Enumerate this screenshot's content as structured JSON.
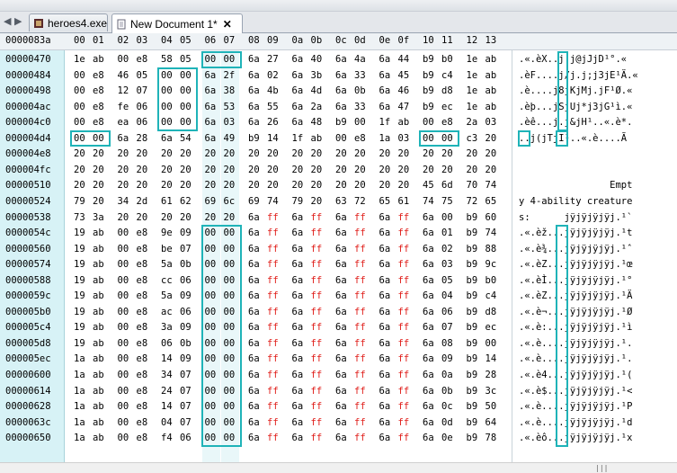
{
  "tabs": [
    {
      "label": "heroes4.exe",
      "icon": "exe-file-icon"
    },
    {
      "label": "New Document 1*",
      "icon": "new-document-icon",
      "close": "✕"
    }
  ],
  "nav": {
    "back": "◀",
    "forward": "▶"
  },
  "header": {
    "offset": "0000083a",
    "columns": [
      "00",
      "01",
      "02",
      "03",
      "04",
      "05",
      "06",
      "07",
      "08",
      "09",
      "0a",
      "0b",
      "0c",
      "0d",
      "0e",
      "0f",
      "10",
      "11",
      "12",
      "13"
    ]
  },
  "rows": [
    {
      "offset": "00000470",
      "bytes": [
        "1e",
        "ab",
        "00",
        "e8",
        "58",
        "05",
        "00",
        "00",
        "6a",
        "27",
        "6a",
        "40",
        "6a",
        "4a",
        "6a",
        "44",
        "b9",
        "b0",
        "1e",
        "ab"
      ],
      "text": ".«.èX..j'j@jJjD¹°.«"
    },
    {
      "offset": "00000484",
      "bytes": [
        "00",
        "e8",
        "46",
        "05",
        "00",
        "00",
        "6a",
        "2f",
        "6a",
        "02",
        "6a",
        "3b",
        "6a",
        "33",
        "6a",
        "45",
        "b9",
        "c4",
        "1e",
        "ab"
      ],
      "text": ".èF....j/j.j;j3jE¹Ä.«"
    },
    {
      "offset": "00000498",
      "bytes": [
        "00",
        "e8",
        "12",
        "07",
        "00",
        "00",
        "6a",
        "38",
        "6a",
        "4b",
        "6a",
        "4d",
        "6a",
        "0b",
        "6a",
        "46",
        "b9",
        "d8",
        "1e",
        "ab"
      ],
      "text": ".è....j8jKjMj.jF¹Ø.«"
    },
    {
      "offset": "000004ac",
      "bytes": [
        "00",
        "e8",
        "fe",
        "06",
        "00",
        "00",
        "6a",
        "53",
        "6a",
        "55",
        "6a",
        "2a",
        "6a",
        "33",
        "6a",
        "47",
        "b9",
        "ec",
        "1e",
        "ab"
      ],
      "text": ".èþ...jSjUj*j3jG¹ì.«"
    },
    {
      "offset": "000004c0",
      "bytes": [
        "00",
        "e8",
        "ea",
        "06",
        "00",
        "00",
        "6a",
        "03",
        "6a",
        "26",
        "6a",
        "48",
        "b9",
        "00",
        "1f",
        "ab",
        "00",
        "e8",
        "2a",
        "03"
      ],
      "text": ".èê...j.j&jH¹..«.è*."
    },
    {
      "offset": "000004d4",
      "bytes": [
        "00",
        "00",
        "6a",
        "28",
        "6a",
        "54",
        "6a",
        "49",
        "b9",
        "14",
        "1f",
        "ab",
        "00",
        "e8",
        "1a",
        "03",
        "00",
        "00",
        "c3",
        "20"
      ],
      "text": "..j(jTjI¹..«.è....Ã "
    },
    {
      "offset": "000004e8",
      "bytes": [
        "20",
        "20",
        "20",
        "20",
        "20",
        "20",
        "20",
        "20",
        "20",
        "20",
        "20",
        "20",
        "20",
        "20",
        "20",
        "20",
        "20",
        "20",
        "20",
        "20"
      ],
      "text": ""
    },
    {
      "offset": "000004fc",
      "bytes": [
        "20",
        "20",
        "20",
        "20",
        "20",
        "20",
        "20",
        "20",
        "20",
        "20",
        "20",
        "20",
        "20",
        "20",
        "20",
        "20",
        "20",
        "20",
        "20",
        "20"
      ],
      "text": ""
    },
    {
      "offset": "00000510",
      "bytes": [
        "20",
        "20",
        "20",
        "20",
        "20",
        "20",
        "20",
        "20",
        "20",
        "20",
        "20",
        "20",
        "20",
        "20",
        "20",
        "20",
        "45",
        "6d",
        "70",
        "74"
      ],
      "text": "                Empt"
    },
    {
      "offset": "00000524",
      "bytes": [
        "79",
        "20",
        "34",
        "2d",
        "61",
        "62",
        "69",
        "6c",
        "69",
        "74",
        "79",
        "20",
        "63",
        "72",
        "65",
        "61",
        "74",
        "75",
        "72",
        "65"
      ],
      "text": "y 4-ability creature"
    },
    {
      "offset": "00000538",
      "bytes": [
        "73",
        "3a",
        "20",
        "20",
        "20",
        "20",
        "20",
        "20",
        "6a",
        "ff",
        "6a",
        "ff",
        "6a",
        "ff",
        "6a",
        "ff",
        "6a",
        "00",
        "b9",
        "60"
      ],
      "text": "s:      jÿjÿjÿjÿj.¹`"
    },
    {
      "offset": "0000054c",
      "bytes": [
        "19",
        "ab",
        "00",
        "e8",
        "9e",
        "09",
        "00",
        "00",
        "6a",
        "ff",
        "6a",
        "ff",
        "6a",
        "ff",
        "6a",
        "ff",
        "6a",
        "01",
        "b9",
        "74"
      ],
      "text": ".«.èž...jÿjÿjÿjÿj.¹t"
    },
    {
      "offset": "00000560",
      "bytes": [
        "19",
        "ab",
        "00",
        "e8",
        "be",
        "07",
        "00",
        "00",
        "6a",
        "ff",
        "6a",
        "ff",
        "6a",
        "ff",
        "6a",
        "ff",
        "6a",
        "02",
        "b9",
        "88"
      ],
      "text": ".«.è¾...jÿjÿjÿjÿj.¹ˆ"
    },
    {
      "offset": "00000574",
      "bytes": [
        "19",
        "ab",
        "00",
        "e8",
        "5a",
        "0b",
        "00",
        "00",
        "6a",
        "ff",
        "6a",
        "ff",
        "6a",
        "ff",
        "6a",
        "ff",
        "6a",
        "03",
        "b9",
        "9c"
      ],
      "text": ".«.èZ...jÿjÿjÿjÿj.¹œ"
    },
    {
      "offset": "00000588",
      "bytes": [
        "19",
        "ab",
        "00",
        "e8",
        "cc",
        "06",
        "00",
        "00",
        "6a",
        "ff",
        "6a",
        "ff",
        "6a",
        "ff",
        "6a",
        "ff",
        "6a",
        "05",
        "b9",
        "b0"
      ],
      "text": ".«.èÌ...jÿjÿjÿjÿj.¹°"
    },
    {
      "offset": "0000059c",
      "bytes": [
        "19",
        "ab",
        "00",
        "e8",
        "5a",
        "09",
        "00",
        "00",
        "6a",
        "ff",
        "6a",
        "ff",
        "6a",
        "ff",
        "6a",
        "ff",
        "6a",
        "04",
        "b9",
        "c4"
      ],
      "text": ".«.èZ...jÿjÿjÿjÿj.¹Ä"
    },
    {
      "offset": "000005b0",
      "bytes": [
        "19",
        "ab",
        "00",
        "e8",
        "ac",
        "06",
        "00",
        "00",
        "6a",
        "ff",
        "6a",
        "ff",
        "6a",
        "ff",
        "6a",
        "ff",
        "6a",
        "06",
        "b9",
        "d8"
      ],
      "text": ".«.è¬...jÿjÿjÿjÿj.¹Ø"
    },
    {
      "offset": "000005c4",
      "bytes": [
        "19",
        "ab",
        "00",
        "e8",
        "3a",
        "09",
        "00",
        "00",
        "6a",
        "ff",
        "6a",
        "ff",
        "6a",
        "ff",
        "6a",
        "ff",
        "6a",
        "07",
        "b9",
        "ec"
      ],
      "text": ".«.è:...jÿjÿjÿjÿj.¹ì"
    },
    {
      "offset": "000005d8",
      "bytes": [
        "19",
        "ab",
        "00",
        "e8",
        "06",
        "0b",
        "00",
        "00",
        "6a",
        "ff",
        "6a",
        "ff",
        "6a",
        "ff",
        "6a",
        "ff",
        "6a",
        "08",
        "b9",
        "00"
      ],
      "text": ".«.è....jÿjÿjÿjÿj.¹."
    },
    {
      "offset": "000005ec",
      "bytes": [
        "1a",
        "ab",
        "00",
        "e8",
        "14",
        "09",
        "00",
        "00",
        "6a",
        "ff",
        "6a",
        "ff",
        "6a",
        "ff",
        "6a",
        "ff",
        "6a",
        "09",
        "b9",
        "14"
      ],
      "text": ".«.è....jÿjÿjÿjÿj.¹."
    },
    {
      "offset": "00000600",
      "bytes": [
        "1a",
        "ab",
        "00",
        "e8",
        "34",
        "07",
        "00",
        "00",
        "6a",
        "ff",
        "6a",
        "ff",
        "6a",
        "ff",
        "6a",
        "ff",
        "6a",
        "0a",
        "b9",
        "28"
      ],
      "text": ".«.è4...jÿjÿjÿjÿj.¹("
    },
    {
      "offset": "00000614",
      "bytes": [
        "1a",
        "ab",
        "00",
        "e8",
        "24",
        "07",
        "00",
        "00",
        "6a",
        "ff",
        "6a",
        "ff",
        "6a",
        "ff",
        "6a",
        "ff",
        "6a",
        "0b",
        "b9",
        "3c"
      ],
      "text": ".«.è$...jÿjÿjÿjÿj.¹<"
    },
    {
      "offset": "00000628",
      "bytes": [
        "1a",
        "ab",
        "00",
        "e8",
        "14",
        "07",
        "00",
        "00",
        "6a",
        "ff",
        "6a",
        "ff",
        "6a",
        "ff",
        "6a",
        "ff",
        "6a",
        "0c",
        "b9",
        "50"
      ],
      "text": ".«.è....jÿjÿjÿjÿj.¹P"
    },
    {
      "offset": "0000063c",
      "bytes": [
        "1a",
        "ab",
        "00",
        "e8",
        "04",
        "07",
        "00",
        "00",
        "6a",
        "ff",
        "6a",
        "ff",
        "6a",
        "ff",
        "6a",
        "ff",
        "6a",
        "0d",
        "b9",
        "64"
      ],
      "text": ".«.è....jÿjÿjÿjÿj.¹d"
    },
    {
      "offset": "00000650",
      "bytes": [
        "1a",
        "ab",
        "00",
        "e8",
        "f4",
        "06",
        "00",
        "00",
        "6a",
        "ff",
        "6a",
        "ff",
        "6a",
        "ff",
        "6a",
        "ff",
        "6a",
        "0e",
        "b9",
        "78"
      ],
      "text": ".«.èô...jÿjÿjÿjÿj.¹x"
    }
  ],
  "colors": {
    "highlight": "#1fb3b8",
    "ff_bytes": "#e0201c",
    "offset_column": "#d7f2f6"
  }
}
